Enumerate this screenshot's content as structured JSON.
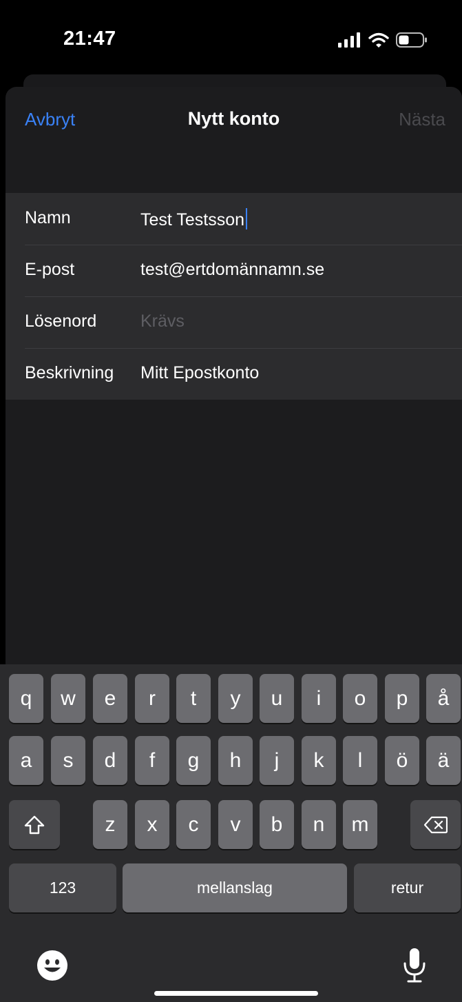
{
  "status_bar": {
    "time": "21:47"
  },
  "nav": {
    "cancel": "Avbryt",
    "title": "Nytt konto",
    "next": "Nästa"
  },
  "form": {
    "name": {
      "label": "Namn",
      "value": "Test Testsson"
    },
    "email": {
      "label": "E-post",
      "value": "test@ertdomännamn.se"
    },
    "password": {
      "label": "Lösenord",
      "placeholder": "Krävs"
    },
    "description": {
      "label": "Beskrivning",
      "value": "Mitt Epostkonto"
    }
  },
  "keyboard": {
    "row1": [
      "q",
      "w",
      "e",
      "r",
      "t",
      "y",
      "u",
      "i",
      "o",
      "p",
      "å"
    ],
    "row2": [
      "a",
      "s",
      "d",
      "f",
      "g",
      "h",
      "j",
      "k",
      "l",
      "ö",
      "ä"
    ],
    "row3": [
      "z",
      "x",
      "c",
      "v",
      "b",
      "n",
      "m"
    ],
    "numbers": "123",
    "space": "mellanslag",
    "return": "retur",
    "icons": {
      "shift": "shift-icon",
      "delete": "backspace-icon",
      "emoji": "emoji-icon",
      "dictation": "microphone-icon"
    }
  },
  "colors": {
    "accent": "#3a82f7",
    "disabled": "#4a4a4e"
  }
}
